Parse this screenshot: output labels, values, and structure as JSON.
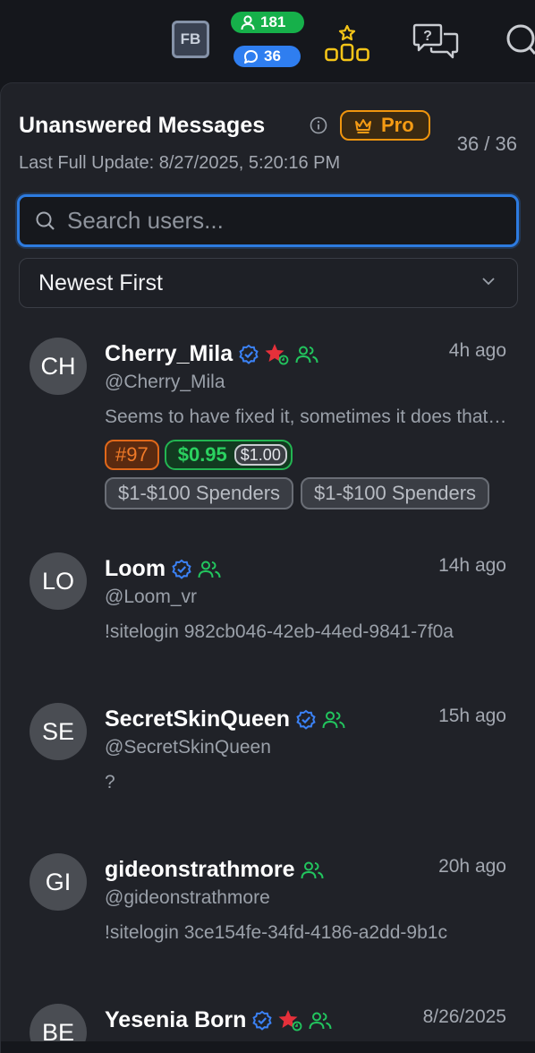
{
  "topbar": {
    "fb_label": "FB",
    "users_count": "181",
    "messages_count": "36",
    "icons": [
      "user-icon",
      "chat-bubble-icon",
      "ranking-icon",
      "help-chat-icon",
      "search-icon"
    ]
  },
  "panel": {
    "title": "Unanswered Messages",
    "pro_label": "Pro",
    "count": "36 / 36",
    "last_update": "Last Full Update: 8/27/2025, 5:20:16 PM",
    "search_placeholder": "Search users...",
    "sort_value": "Newest First"
  },
  "conversations": [
    {
      "initials": "CH",
      "name": "Cherry_Mila",
      "time": "4h ago",
      "handle": "@Cherry_Mila",
      "preview": "Seems to have fixed it, sometimes it does that and can get stuck",
      "rank": "#97",
      "spent": "$0.95",
      "spent_original": "$1.00",
      "groups": [
        "$1-$100 Spenders",
        "$1-$100 Spenders"
      ],
      "badges": [
        "verified",
        "star",
        "group"
      ]
    },
    {
      "initials": "LO",
      "name": "Loom",
      "time": "14h ago",
      "handle": "@Loom_vr",
      "preview": "!sitelogin 982cb046-42eb-44ed-9841-7f0a",
      "badges": [
        "verified",
        "group"
      ]
    },
    {
      "initials": "SE",
      "name": "SecretSkinQueen",
      "time": "15h ago",
      "handle": "@SecretSkinQueen",
      "preview": "?",
      "badges": [
        "verified",
        "group"
      ]
    },
    {
      "initials": "GI",
      "name": "gideonstrathmore",
      "time": "20h ago",
      "handle": "@gideonstrathmore",
      "preview": "!sitelogin 3ce154fe-34fd-4186-a2dd-9b1c",
      "badges": [
        "group"
      ]
    },
    {
      "initials": "BE",
      "name": "Yesenia Born",
      "time": "8/26/2025",
      "badges": [
        "verified",
        "star",
        "group"
      ]
    }
  ],
  "colors": {
    "background": "#15171c",
    "panel": "#202228",
    "accent_blue": "#2d7be0",
    "users_green": "#16b04a",
    "pro_orange": "#f0950e",
    "money_green": "#2bd160",
    "rank_orange": "#f07a28",
    "verified_blue": "#3b82f6",
    "star_red": "#e5303a",
    "group_green": "#22c55e"
  }
}
